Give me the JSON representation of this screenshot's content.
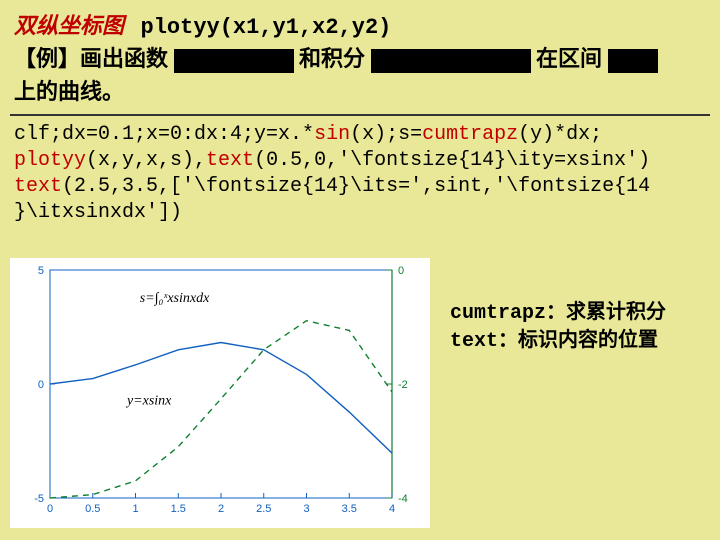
{
  "title": {
    "heading": "双纵坐标图",
    "command": "plotyy(x1,y1,x2,y2)"
  },
  "example": {
    "prefix": "【例】画出函数",
    "mid1": "和积分",
    "mid2": "在区间",
    "suffix": "上的曲线。"
  },
  "code": {
    "l1a": "clf;dx=0.1;x=0:dx:4;y=x.*",
    "l1b": "sin",
    "l1c": "(x);s=",
    "l1d": "cumtrapz",
    "l1e": "(y)*dx;",
    "l2a": "plotyy",
    "l2b": "(x,y,x,s),",
    "l2c": "text",
    "l2d": "(0.5,0,'\\fontsize{14}\\ity=xsinx')",
    "l3a": "text",
    "l3b": "(2.5,3.5,['\\fontsize{14}\\its=',sint,'\\fontsize{14",
    "l4": "}\\itxsinxdx'])"
  },
  "notes": {
    "n1": "cumtrapz：求累计积分",
    "n2": "text：标识内容的位置"
  },
  "chart_data": {
    "type": "line",
    "x": [
      0,
      0.5,
      1,
      1.5,
      2,
      2.5,
      3,
      3.5,
      4
    ],
    "series": [
      {
        "name": "y=xsinx",
        "axis": "left",
        "values": [
          0,
          0.24,
          0.84,
          1.5,
          1.82,
          1.5,
          0.42,
          -1.23,
          -3.03
        ]
      },
      {
        "name": "s=∫xsinxdx",
        "axis": "right",
        "values": [
          0,
          0.06,
          0.3,
          0.9,
          1.74,
          2.6,
          3.11,
          2.94,
          1.86
        ]
      }
    ],
    "left_ylim": [
      -5,
      5
    ],
    "right_ylim": [
      0,
      4
    ],
    "xlim": [
      0,
      4
    ],
    "xticks": [
      0,
      0.5,
      1,
      1.5,
      2,
      2.5,
      3,
      3.5,
      4
    ],
    "left_yticks": [
      -5,
      0,
      5
    ],
    "right_yticks": [
      0,
      -2,
      -4
    ],
    "labels": {
      "y_label": "y=xsinx",
      "s_label": "s=∫₀ˣxsinxdx"
    }
  }
}
